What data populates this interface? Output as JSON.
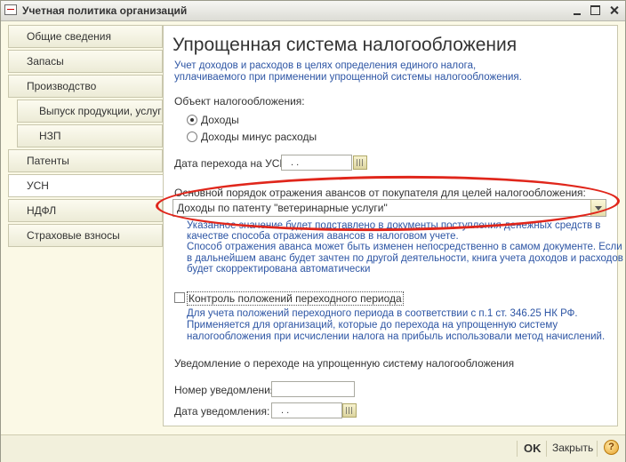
{
  "window": {
    "title": "Учетная политика организаций"
  },
  "sidebar": {
    "items": [
      {
        "label": "Общие сведения"
      },
      {
        "label": "Запасы"
      },
      {
        "label": "Производство"
      },
      {
        "label": "Выпуск продукции, услуг"
      },
      {
        "label": "НЗП"
      },
      {
        "label": "Патенты"
      },
      {
        "label": "УСН"
      },
      {
        "label": "НДФЛ"
      },
      {
        "label": "Страховые взносы"
      }
    ],
    "active": "УСН"
  },
  "usn": {
    "heading": "Упрощенная система налогообложения",
    "intro_line1": "Учет доходов и расходов в целях определения единого налога,",
    "intro_line2": "уплачиваемого при применении упрощенной системы налогообложения.",
    "object_label": "Объект налогообложения:",
    "radio_income": "Доходы",
    "radio_income_minus": "Доходы минус расходы",
    "transition_date_label": "Дата перехода на УСН:",
    "transition_date_value": " .  .",
    "advance_label": "Основной порядок отражения авансов от покупателя для целей налогообложения:",
    "advance_value": "Доходы по патенту \"ветеринарные услуги\"",
    "advance_help_line1": "Указанное значение будет подставлено в документы поступления денежных средств в",
    "advance_help_line2": "качестве способа отражения авансов в налоговом учете.",
    "advance_help_line3": "Способ отражения аванса может быть изменен непосредственно в самом документе. Если",
    "advance_help_line4": "в дальнейшем аванс будет зачтен по другой деятельности, книга учета доходов и расходов",
    "advance_help_line5": "будет скорректирована автоматически",
    "transition_check_label": "Контроль положений переходного периода",
    "transition_help_line1": "Для учета положений переходного периода в соответствии с п.1 ст. 346.25 НК РФ.",
    "transition_help_line2": "Применяется для организаций, которые до перехода на упрощенную систему",
    "transition_help_line3": "налогообложения при исчислении налога на прибыль использовали метод начислений.",
    "notice_heading": "Уведомление о переходе на упрощенную систему налогообложения",
    "notice_number_label": "Номер уведомления:",
    "notice_number_value": "",
    "notice_date_label": "Дата уведомления:",
    "notice_date_value": " .  ."
  },
  "footer": {
    "ok": "OK",
    "close": "Закрыть",
    "help": "?"
  }
}
